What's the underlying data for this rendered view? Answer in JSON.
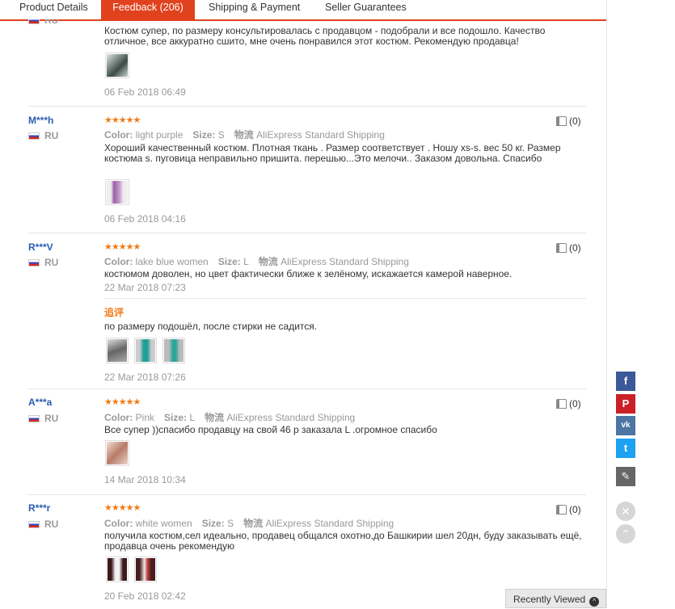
{
  "tabs": [
    {
      "label": "Product Details"
    },
    {
      "label": "Feedback (206)"
    },
    {
      "label": "Shipping & Payment"
    },
    {
      "label": "Seller Guarantees"
    }
  ],
  "labels": {
    "color": "Color:",
    "size": "Size:",
    "shipping_cn": "物流",
    "additional_feedback": "追评"
  },
  "reviews": [
    {
      "country": "RU",
      "text": "Костюм супер, по размеру консультировалась с продавцом - подобрали и все подошло. Качество отличное, все аккуратно сшито, мне очень понравился этот костюм. Рекомендую продавца!",
      "date": "06 Feb 2018 06:49"
    },
    {
      "user": "M***h",
      "country": "RU",
      "stars": "★★★★★",
      "color": "light purple",
      "size": "S",
      "shipping": "AliExpress Standard Shipping",
      "helpful": "(0)",
      "text": "Хороший качественный костюм. Плотная ткань . Размер соответствует . Ношу xs-s. вес 50 кг. Размер костюма s. пуговица неправильно пришита. перешью...Это мелочи.. Заказом довольна. Спасибо",
      "date": "06 Feb 2018 04:16"
    },
    {
      "user": "R***V",
      "country": "RU",
      "stars": "★★★★★",
      "color": "lake blue women",
      "size": "L",
      "shipping": "AliExpress Standard Shipping",
      "helpful": "(0)",
      "text": "костюмом доволен, но цвет фактически ближе к зелёному, искажается камерой наверное.",
      "date": "22 Mar 2018 07:23",
      "additional_text": "по размеру подошёл, после стирки не садится.",
      "additional_date": "22 Mar 2018 07:26"
    },
    {
      "user": "A***a",
      "country": "RU",
      "stars": "★★★★★",
      "color": "Pink",
      "size": "L",
      "shipping": "AliExpress Standard Shipping",
      "helpful": "(0)",
      "text": "Все супер ))спасибо продавцу на свой 46 р заказала L .огромное спасибо",
      "date": "14 Mar 2018 10:34"
    },
    {
      "user": "R***r",
      "country": "RU",
      "stars": "★★★★★",
      "color": "white women",
      "size": "S",
      "shipping": "AliExpress Standard Shipping",
      "helpful": "(0)",
      "text": "получила костюм,сел идеально, продавец общался охотно,до Башкирии шел 20дн, буду заказывать ещё, продавца очень рекомендую",
      "date": "20 Feb 2018 02:42"
    }
  ],
  "share": {
    "facebook": "f",
    "pinterest": "P",
    "vk": "vk",
    "twitter": "t",
    "edit": "✎"
  },
  "round_buttons": {
    "close": "✕",
    "top": "⌃"
  },
  "recently_viewed": {
    "label": "Recently Viewed",
    "arrow": "^"
  },
  "colors": {
    "accent": "#e0421e",
    "star": "#f07a14",
    "link": "#2a5db0"
  }
}
